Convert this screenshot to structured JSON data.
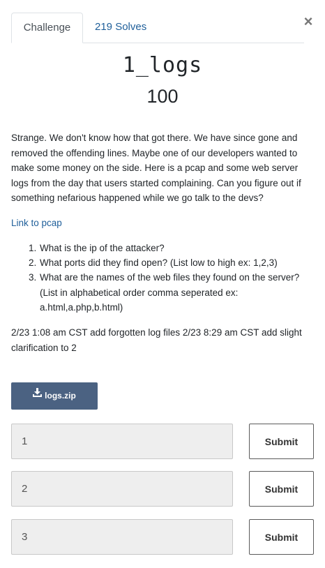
{
  "tabs": {
    "challenge": "Challenge",
    "solves": "219 Solves"
  },
  "close_label": "×",
  "challenge": {
    "name": "1_logs",
    "points": "100",
    "description": "Strange. We don't know how that got there. We have since gone and removed the offending lines. Maybe one of our developers wanted to make some money on the side. Here is a pcap and some web server logs from the day that users started complaining. Can you figure out if something nefarious happened while we go talk to the devs?",
    "link_text": "Link to pcap",
    "questions": [
      {
        "num": "1.",
        "text": "What is the ip of the attacker?"
      },
      {
        "num": "2.",
        "text": "What ports did they find open? (List low to high ex: 1,2,3)"
      },
      {
        "num": "3.",
        "text": "What are the names of the web files they found on the server? (List in alphabetical order comma seperated ex: a.html,a.php,b.html)"
      }
    ],
    "note": "2/23 1:08 am CST add forgotten log files 2/23 8:29 am CST add slight clarification to 2"
  },
  "download": {
    "label": "logs.zip",
    "icon": "download-icon"
  },
  "answers": [
    {
      "placeholder": "1",
      "submit_label": "Submit"
    },
    {
      "placeholder": "2",
      "submit_label": "Submit"
    },
    {
      "placeholder": "3",
      "submit_label": "Submit"
    }
  ],
  "colors": {
    "link": "#1f5f9a",
    "download_button": "#4b6282",
    "input_background": "#eeeeee"
  }
}
